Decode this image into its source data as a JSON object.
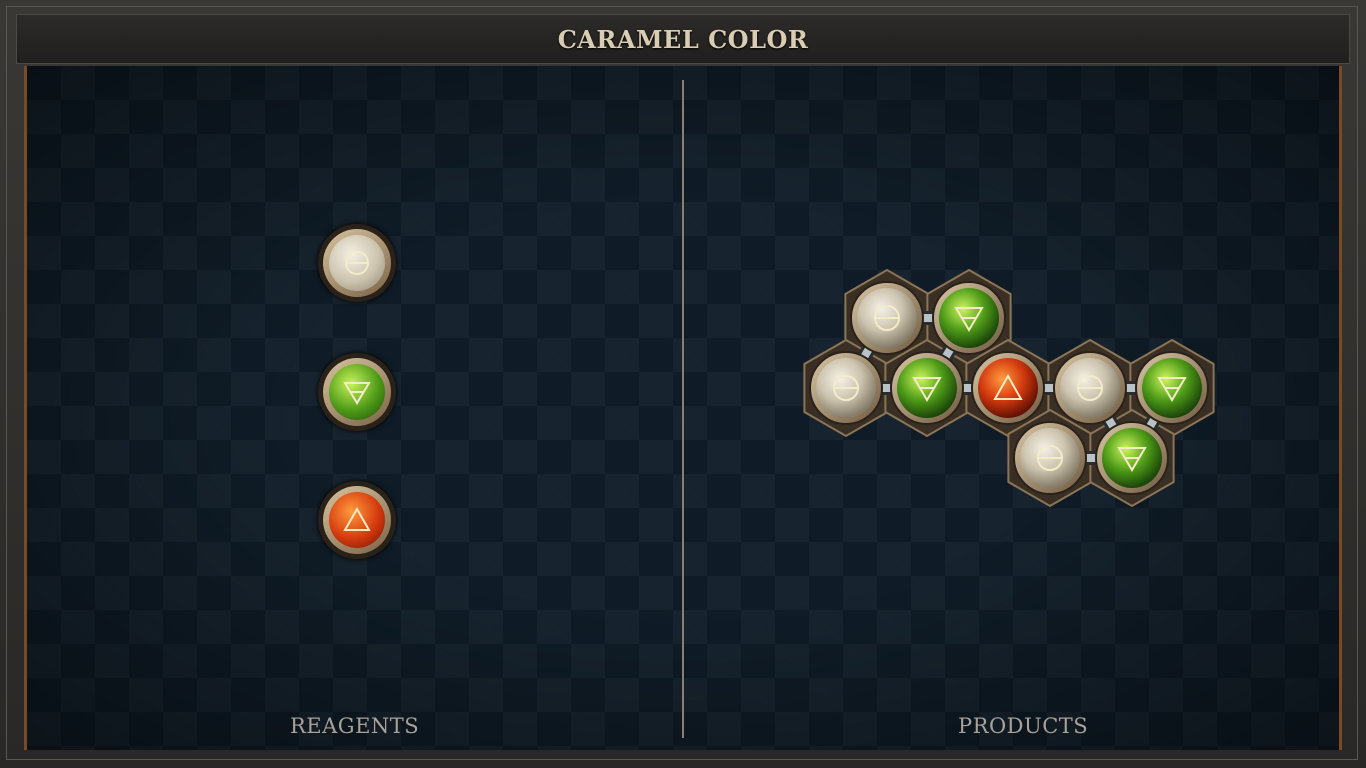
{
  "title": "CARAMEL COLOR",
  "panels": {
    "reagents_label": "REAGENTS",
    "products_label": "PRODUCTS"
  },
  "reagents": [
    {
      "element": "salt",
      "icon": "salt-icon"
    },
    {
      "element": "water",
      "icon": "water-icon"
    },
    {
      "element": "fire",
      "icon": "fire-icon"
    }
  ],
  "product": {
    "atoms": [
      {
        "element": "salt"
      },
      {
        "element": "water"
      },
      {
        "element": "salt"
      },
      {
        "element": "water"
      },
      {
        "element": "fire"
      },
      {
        "element": "salt"
      },
      {
        "element": "water"
      },
      {
        "element": "salt"
      },
      {
        "element": "water"
      }
    ],
    "bonds": [
      [
        0,
        1
      ],
      [
        0,
        2
      ],
      [
        1,
        3
      ],
      [
        2,
        3
      ],
      [
        3,
        4
      ],
      [
        4,
        5
      ],
      [
        5,
        6
      ],
      [
        5,
        8
      ],
      [
        6,
        8
      ],
      [
        7,
        8
      ]
    ]
  },
  "colors": {
    "salt": "#e3dccb",
    "water": "#5fb21e",
    "fire": "#e0461a",
    "frame_accent": "#7a4a25",
    "board_bg": "#0f1c27",
    "title_text": "#d8ccb2"
  }
}
